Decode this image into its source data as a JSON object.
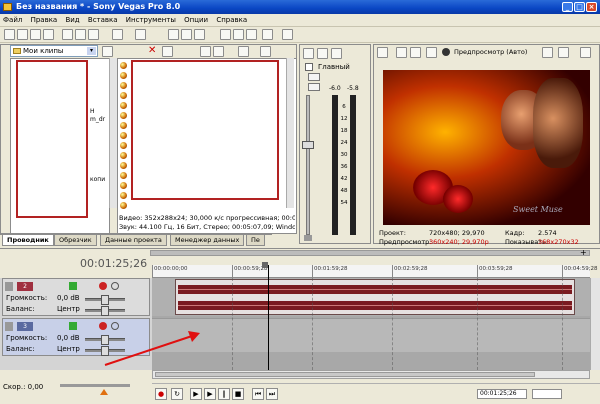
{
  "window": {
    "title": "Без названия * - Sony Vegas Pro 8.0"
  },
  "menu": [
    "Файл",
    "Правка",
    "Вид",
    "Вставка",
    "Инструменты",
    "Опции",
    "Справка"
  ],
  "explorer": {
    "folder": "Мои клипы",
    "frag1": "H",
    "frag2": "m_dr",
    "frag3": "копи"
  },
  "media_info": {
    "line1": "Видео: 352x288x24; 30,000 к/с прогрессивная; 00:05:07,",
    "line2": "Звук: 44.100 Гц, 16 Бит, Стерео; 00:05:07,09; Windows Me"
  },
  "tabs": [
    "Проводник",
    "Обрезчик",
    "Данные проекта",
    "Менеджер данных",
    "Пе"
  ],
  "mixer": {
    "label": "Главный",
    "left_db": "-6.0",
    "right_db": "-5.8",
    "scale": [
      "6",
      "12",
      "18",
      "24",
      "30",
      "36",
      "42",
      "48",
      "54"
    ]
  },
  "preview": {
    "mode": "Предпросмотр (Авто)",
    "project_label": "Проект:",
    "project_value": "720x480; 29,970",
    "preview_label": "Предпросмотр:",
    "preview_value": "360x240; 29,970p",
    "frame_label": "Кадр:",
    "frame_value": "2.574",
    "show_label": "Показывать:",
    "show_value": "368x270x32",
    "watermark": "Sweet Muse",
    "accent": "#cc0000"
  },
  "timeline": {
    "time": "00:01:25;26",
    "ruler": [
      "00:00:00;00",
      "00:00:59;28",
      "00:01:59;28",
      "00:02:59;28",
      "00:03:59;28",
      "00:04:59;28"
    ],
    "ruler_frag": "00:00:59;28",
    "tracks": [
      {
        "num": "2",
        "vol_label": "Громкость:",
        "vol_value": "0,0 dB",
        "pan_label": "Баланс:",
        "pan_value": "Центр"
      },
      {
        "num": "3",
        "vol_label": "Громкость:",
        "vol_value": "0,0 dB",
        "pan_label": "Баланс:",
        "pan_value": "Центр"
      }
    ],
    "rate": "Скор.: 0,00",
    "end_time": "00:01:25;26",
    "plus_marker": "+"
  }
}
